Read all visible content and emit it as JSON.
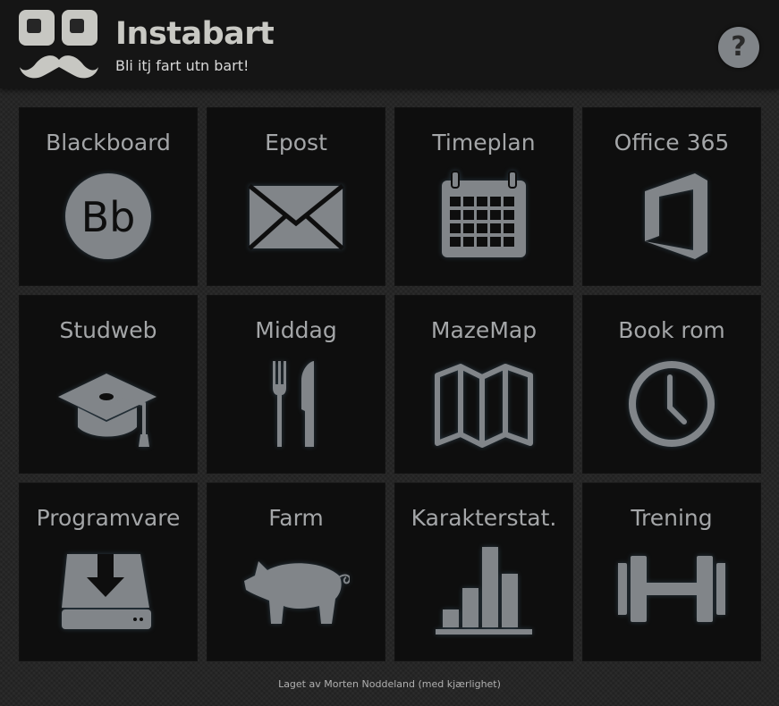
{
  "header": {
    "title": "Instabart",
    "subtitle": "Bli itj fart utn bart!",
    "help_label": "?"
  },
  "tiles": [
    {
      "label": "Blackboard",
      "icon": "blackboard-icon",
      "icon_text": "Bb"
    },
    {
      "label": "Epost",
      "icon": "envelope-icon"
    },
    {
      "label": "Timeplan",
      "icon": "calendar-icon"
    },
    {
      "label": "Office 365",
      "icon": "office-icon"
    },
    {
      "label": "Studweb",
      "icon": "graduation-cap-icon"
    },
    {
      "label": "Middag",
      "icon": "fork-knife-icon"
    },
    {
      "label": "MazeMap",
      "icon": "map-icon"
    },
    {
      "label": "Book rom",
      "icon": "clock-icon"
    },
    {
      "label": "Programvare",
      "icon": "download-tray-icon"
    },
    {
      "label": "Farm",
      "icon": "pig-icon"
    },
    {
      "label": "Karakterstat.",
      "icon": "bar-chart-icon"
    },
    {
      "label": "Trening",
      "icon": "dumbbell-icon"
    }
  ],
  "footer": {
    "text": "Laget av Morten Noddeland (med kjærlighet)"
  },
  "colors": {
    "background": "#262626",
    "header": "#151515",
    "tile": "#0e0e0e",
    "icon": "#818589",
    "text": "#a4a6a8"
  }
}
